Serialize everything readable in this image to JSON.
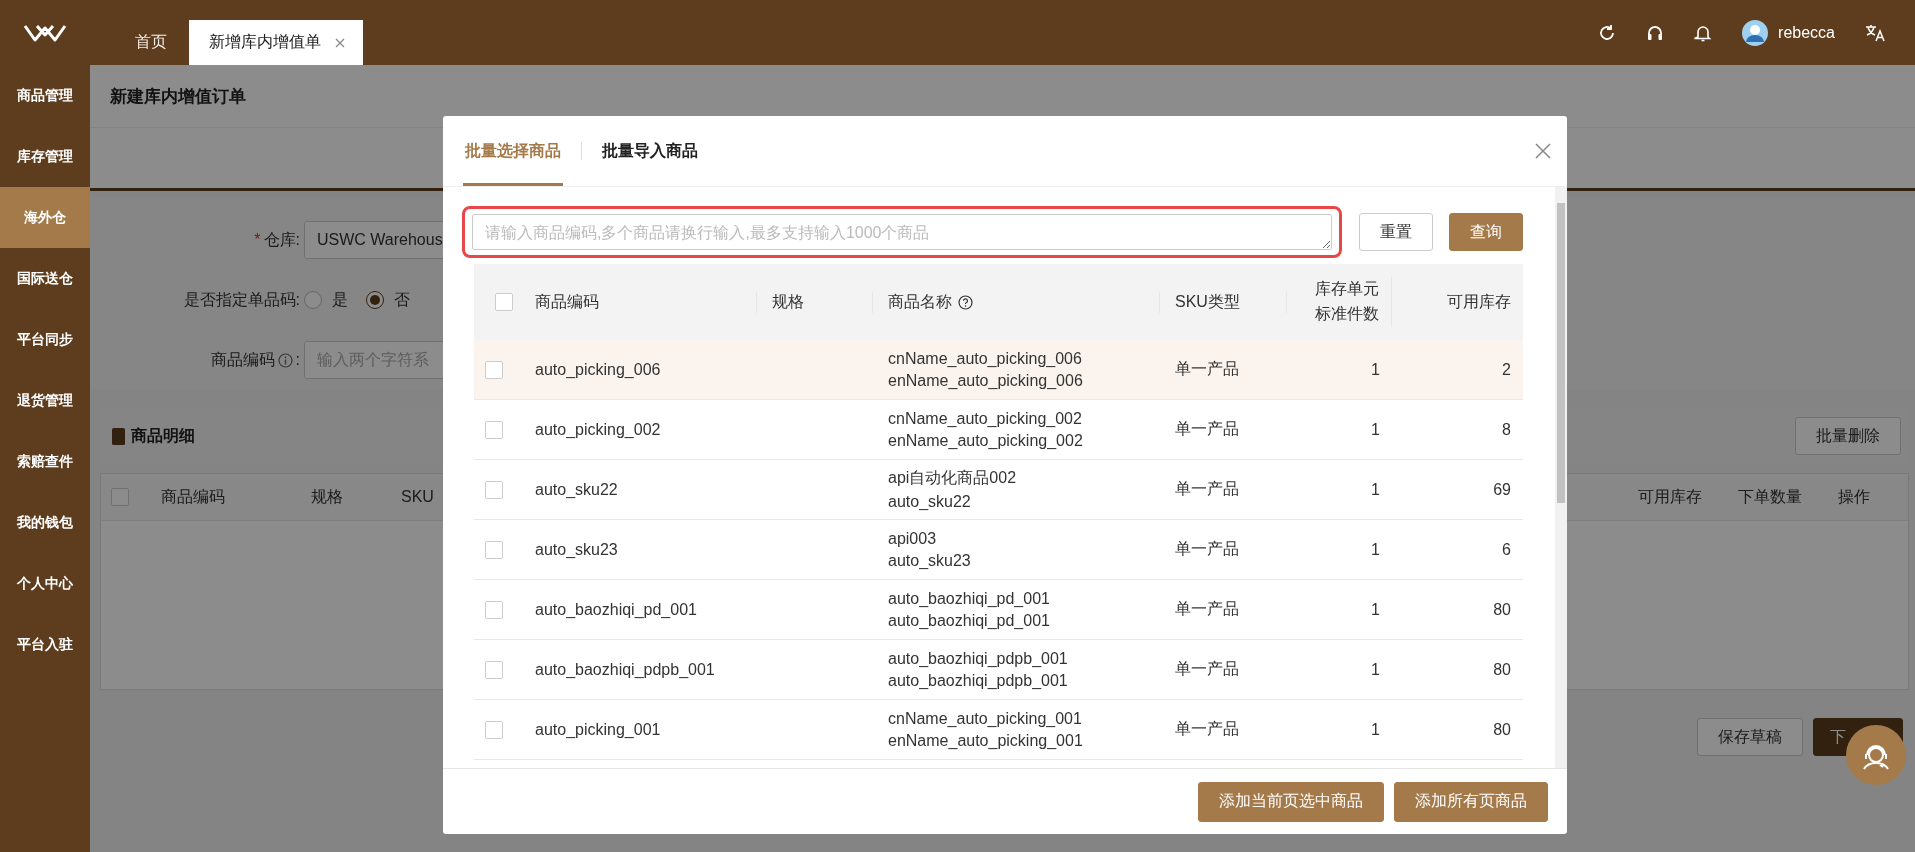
{
  "header": {
    "tabs": [
      {
        "label": "首页",
        "selected": false,
        "closable": false
      },
      {
        "label": "新增库内增值单",
        "selected": true,
        "closable": true
      }
    ],
    "user": "rebecca"
  },
  "sidebar": {
    "items": [
      {
        "label": "商品管理",
        "selected": false
      },
      {
        "label": "库存管理",
        "selected": false
      },
      {
        "label": "海外仓",
        "selected": true
      },
      {
        "label": "国际送仓",
        "selected": false
      },
      {
        "label": "平台同步",
        "selected": false
      },
      {
        "label": "退货管理",
        "selected": false
      },
      {
        "label": "索赔查件",
        "selected": false
      },
      {
        "label": "我的钱包",
        "selected": false
      },
      {
        "label": "个人中心",
        "selected": false
      },
      {
        "label": "平台入驻",
        "selected": false
      }
    ]
  },
  "page": {
    "title": "新建库内增值订单",
    "form": [
      {
        "kind": "select",
        "mark": "*",
        "label": "仓库:",
        "value": "USWC Warehous"
      },
      {
        "kind": "radio",
        "label": "是否指定单品码:",
        "options": [
          {
            "label": "是",
            "selected": false
          },
          {
            "label": "否",
            "selected": true
          }
        ]
      },
      {
        "kind": "input",
        "label": "商品编码",
        "info": true,
        "colon": ":",
        "placeholder": "输入两个字符系"
      }
    ],
    "detail": {
      "title": "商品明细",
      "batch_delete": "批量删除",
      "all_checked": false,
      "columns_left": [
        "商品编码",
        "规格",
        "SKU"
      ],
      "columns_right": [
        "可用库存",
        "下单数量",
        "操作"
      ]
    },
    "actions": [
      {
        "label": "保存草稿",
        "kind": "secondary"
      },
      {
        "label": "下",
        "kind": "primary"
      }
    ]
  },
  "dialog": {
    "tabs": [
      {
        "label": "批量选择商品",
        "selected": true
      },
      {
        "label": "批量导入商品",
        "selected": false
      }
    ],
    "search": {
      "placeholder": "请输入商品编码,多个商品请换行输入,最多支持输入1000个商品",
      "highlighted": true
    },
    "reset": "重置",
    "query": "查询",
    "table": {
      "all_checked": false,
      "columns": [
        "商品编码",
        "规格",
        "商品名称",
        "SKU类型",
        "库存单元标准件数",
        "可用库存"
      ],
      "rows": [
        {
          "code": "auto_picking_006",
          "names": [
            "cnName_auto_picking_006",
            "enName_auto_picking_006"
          ],
          "type": "单一产品",
          "units": "1",
          "available": "2",
          "checked": false,
          "highlighted": true
        },
        {
          "code": "auto_picking_002",
          "names": [
            "cnName_auto_picking_002",
            "enName_auto_picking_002"
          ],
          "type": "单一产品",
          "units": "1",
          "available": "8",
          "checked": false,
          "highlighted": false
        },
        {
          "code": "auto_sku22",
          "names": [
            "api自动化商品002",
            "auto_sku22"
          ],
          "type": "单一产品",
          "units": "1",
          "available": "69",
          "checked": false,
          "highlighted": false
        },
        {
          "code": "auto_sku23",
          "names": [
            "api003",
            "auto_sku23"
          ],
          "type": "单一产品",
          "units": "1",
          "available": "6",
          "checked": false,
          "highlighted": false
        },
        {
          "code": "auto_baozhiqi_pd_001",
          "names": [
            "auto_baozhiqi_pd_001",
            "auto_baozhiqi_pd_001"
          ],
          "type": "单一产品",
          "units": "1",
          "available": "80",
          "checked": false,
          "highlighted": false
        },
        {
          "code": "auto_baozhiqi_pdpb_001",
          "names": [
            "auto_baozhiqi_pdpb_001",
            "auto_baozhiqi_pdpb_001"
          ],
          "type": "单一产品",
          "units": "1",
          "available": "80",
          "checked": false,
          "highlighted": false
        },
        {
          "code": "auto_picking_001",
          "names": [
            "cnName_auto_picking_001",
            "enName_auto_picking_001"
          ],
          "type": "单一产品",
          "units": "1",
          "available": "80",
          "checked": false,
          "highlighted": false
        }
      ]
    },
    "footer_buttons": [
      "添加当前页选中商品",
      "添加所有页商品"
    ]
  }
}
